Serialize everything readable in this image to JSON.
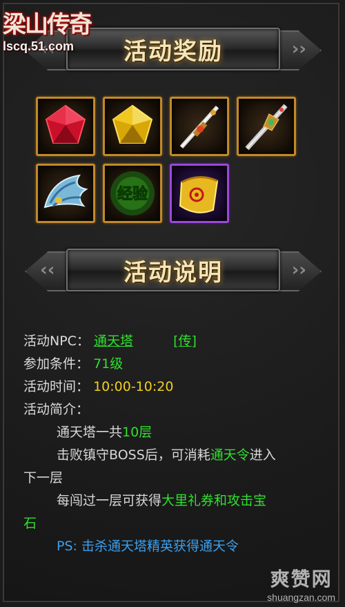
{
  "logo": {
    "title": "梁山传奇",
    "url": "lscq.51.com"
  },
  "banners": {
    "rewards": "活动奖励",
    "description": "活动说明"
  },
  "rewards": [
    {
      "icon": "red-gem-icon"
    },
    {
      "icon": "yellow-gem-icon"
    },
    {
      "icon": "sword-icon"
    },
    {
      "icon": "ornate-sword-icon"
    },
    {
      "icon": "phoenix-wing-icon"
    },
    {
      "icon": "experience-icon",
      "label": "经验"
    },
    {
      "icon": "scroll-icon"
    }
  ],
  "info": {
    "npc_label": "活动NPC：",
    "npc_value": "通天塔",
    "npc_link": "[传]",
    "condition_label": "参加条件：",
    "condition_value": "71级",
    "time_label": "活动时间：",
    "time_value": "10:00-10:20",
    "intro_label": "活动简介：",
    "line1_pre": "通天塔一共",
    "line1_hl": "10层",
    "line2_pre": "击败镇守BOSS后，可消耗",
    "line2_hl": "通天令",
    "line2_post": "进入",
    "line3": "下一层",
    "line4_pre": "每闯过一层可获得",
    "line4_hl": "大里礼券和攻击宝",
    "line5_hl": "石",
    "ps_label": "PS:",
    "ps_text": "击杀通天塔精英获得通天令"
  },
  "watermark": {
    "top": "爽赞网",
    "bottom": "shuangzan.com"
  },
  "colors": {
    "highlight_green": "#2fe02f",
    "time_yellow": "#f0d020",
    "ps_blue": "#3aa0f0",
    "slot_gold": "#c28a2a",
    "slot_purple": "#9a4ad8"
  }
}
